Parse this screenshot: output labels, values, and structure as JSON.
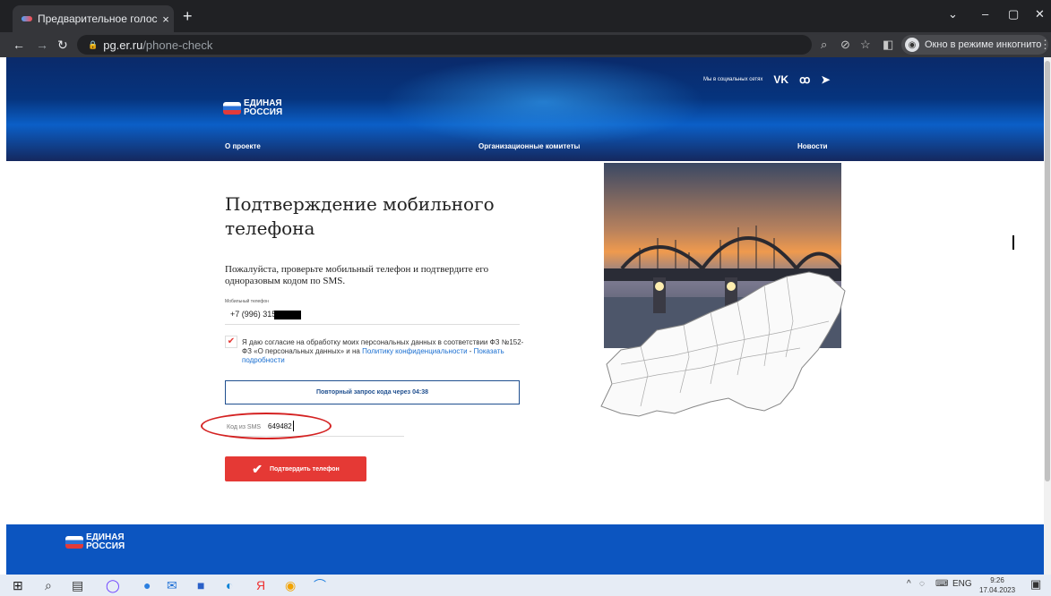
{
  "browser": {
    "tab_title": "Предварительное голосование",
    "tab_close": "×",
    "new_tab": "+",
    "url_domain": "pg.er.ru",
    "url_path": "/phone-check",
    "incognito_label": "Окно в режиме инкогнито",
    "controls": {
      "minimize": "–",
      "maximize": "▢",
      "close": "✕",
      "dropdown": "⌄"
    }
  },
  "site": {
    "logo_line1": "ЕДИНАЯ",
    "logo_line2": "РОССИЯ",
    "social_label": "Мы в социальных сетях",
    "social_icons": [
      "vk-icon",
      "odnoklassniki-icon",
      "telegram-icon"
    ],
    "nav": {
      "about": "О проекте",
      "committees": "Организационные комитеты",
      "news": "Новости"
    }
  },
  "form": {
    "title": "Подтверждение мобильного телефона",
    "description": "Пожалуйста, проверьте мобильный телефон и подтвердите его одноразовым кодом по SMS.",
    "phone_label": "Мобильный телефон",
    "phone_value": "+7 (996) 315",
    "consent_checked": true,
    "consent_text": "Я даю согласие на обработку моих персональных данных в соответствии ФЗ №152-ФЗ «О персональных данных» и на ",
    "consent_link1": "Политику конфиденциальности",
    "consent_sep": " - ",
    "consent_link2": "Показать подробности",
    "resend_label": "Повторный запрос кода через 04:38",
    "sms_label": "Код из SMS",
    "sms_value": "649482",
    "submit_label": "Подтвердить телефон"
  },
  "taskbar": {
    "lang": "ENG",
    "time": "9:26",
    "date": "17.04.2023"
  },
  "colors": {
    "brand_blue": "#0c55c0",
    "accent_red": "#e53935",
    "link": "#1a6fd1"
  }
}
